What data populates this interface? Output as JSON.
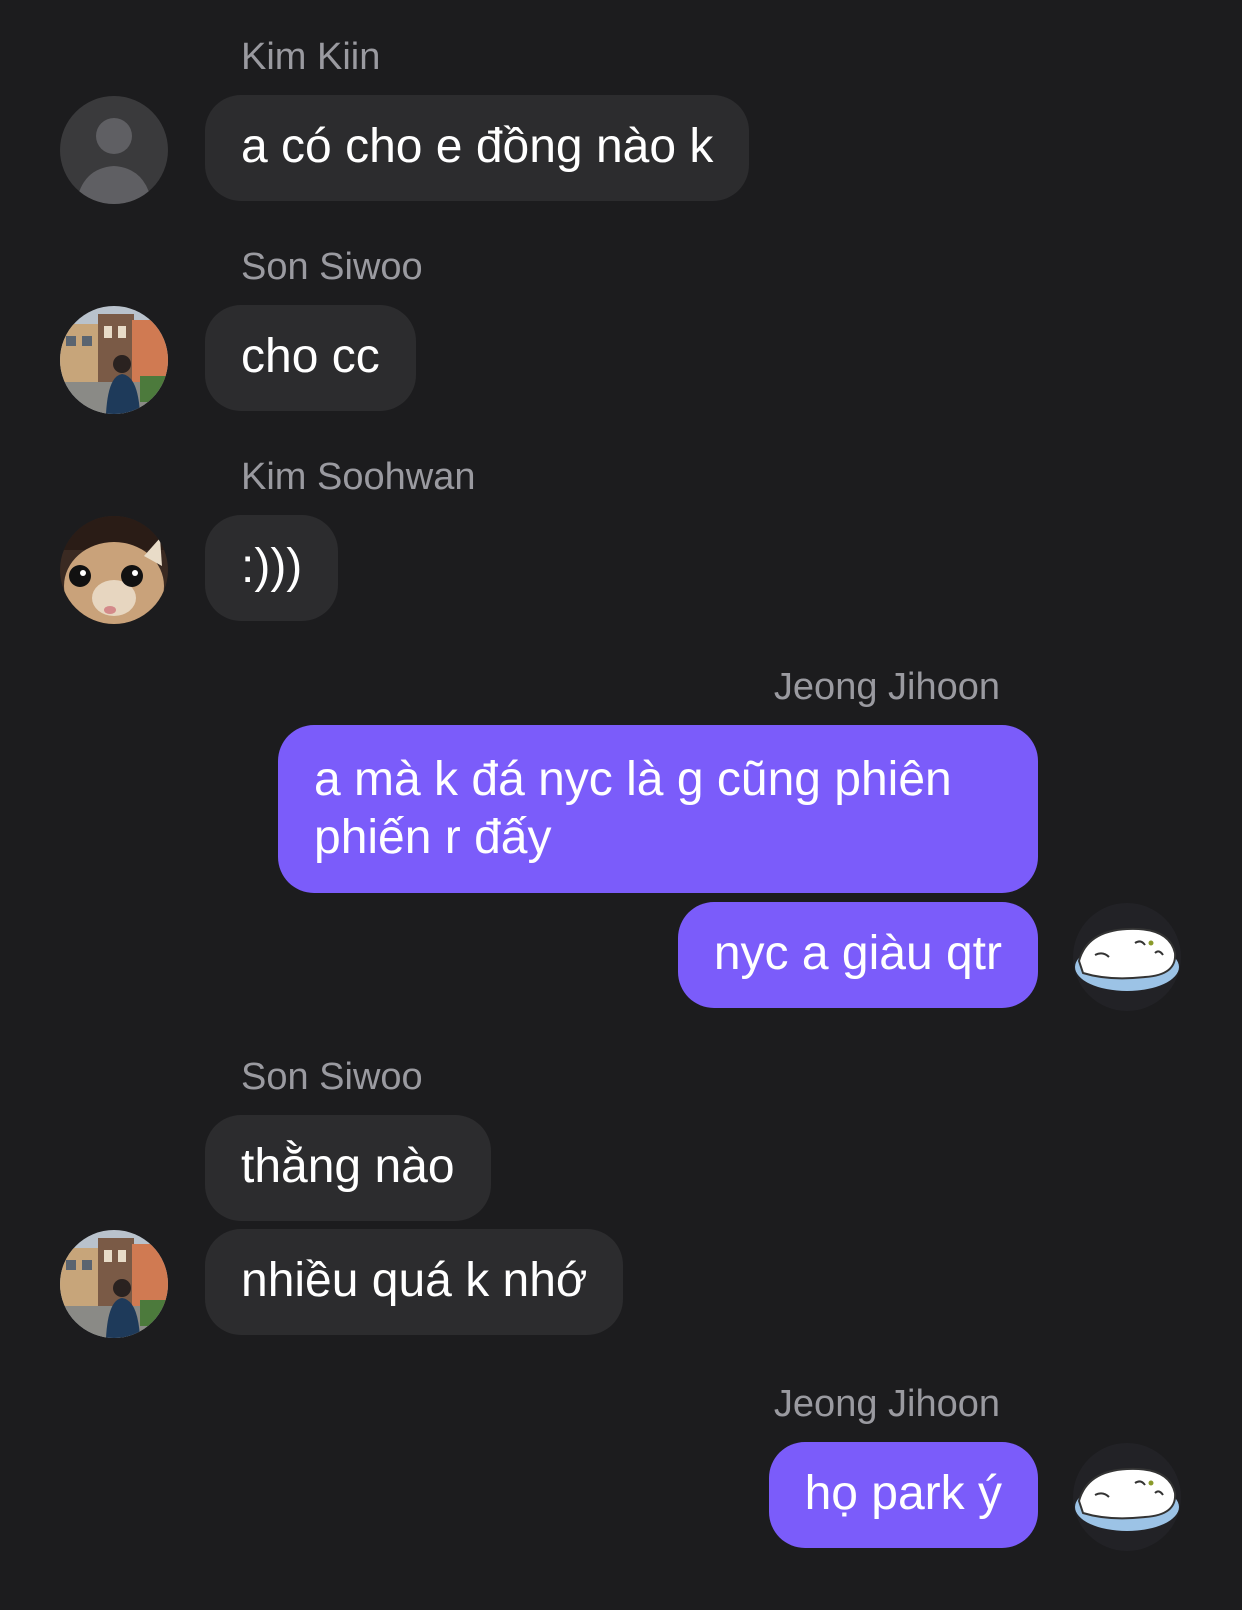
{
  "messages": [
    {
      "sender": "Kim Kiin",
      "text": "a có cho e đồng nào k",
      "side": "incoming",
      "avatar": "default-person-icon"
    },
    {
      "sender": "Son Siwoo",
      "text": "cho cc",
      "side": "incoming",
      "avatar": "photo-avatar-street"
    },
    {
      "sender": "Kim Soohwan",
      "text": ":)))",
      "side": "incoming",
      "avatar": "photo-avatar-cat"
    },
    {
      "sender": "Jeong Jihoon",
      "text": "a mà k đá nyc là g cũng phiên phiến r đấy",
      "side": "outgoing"
    },
    {
      "sender": "Jeong Jihoon",
      "text": "nyc a giàu qtr",
      "side": "outgoing",
      "avatar": "cartoon-blob-avatar"
    },
    {
      "sender": "Son Siwoo",
      "text": "thằng nào",
      "side": "incoming"
    },
    {
      "sender": "Son Siwoo",
      "text": "nhiều quá k nhớ",
      "side": "incoming",
      "avatar": "photo-avatar-street"
    },
    {
      "sender": "Jeong Jihoon",
      "text": "họ park ý",
      "side": "outgoing",
      "avatar": "cartoon-blob-avatar"
    }
  ],
  "colors": {
    "background": "#1c1c1e",
    "incoming_bubble": "#2c2c2e",
    "outgoing_bubble": "#7b5cfa",
    "sender_name": "#9a9aa0",
    "message_text": "#ffffff"
  }
}
